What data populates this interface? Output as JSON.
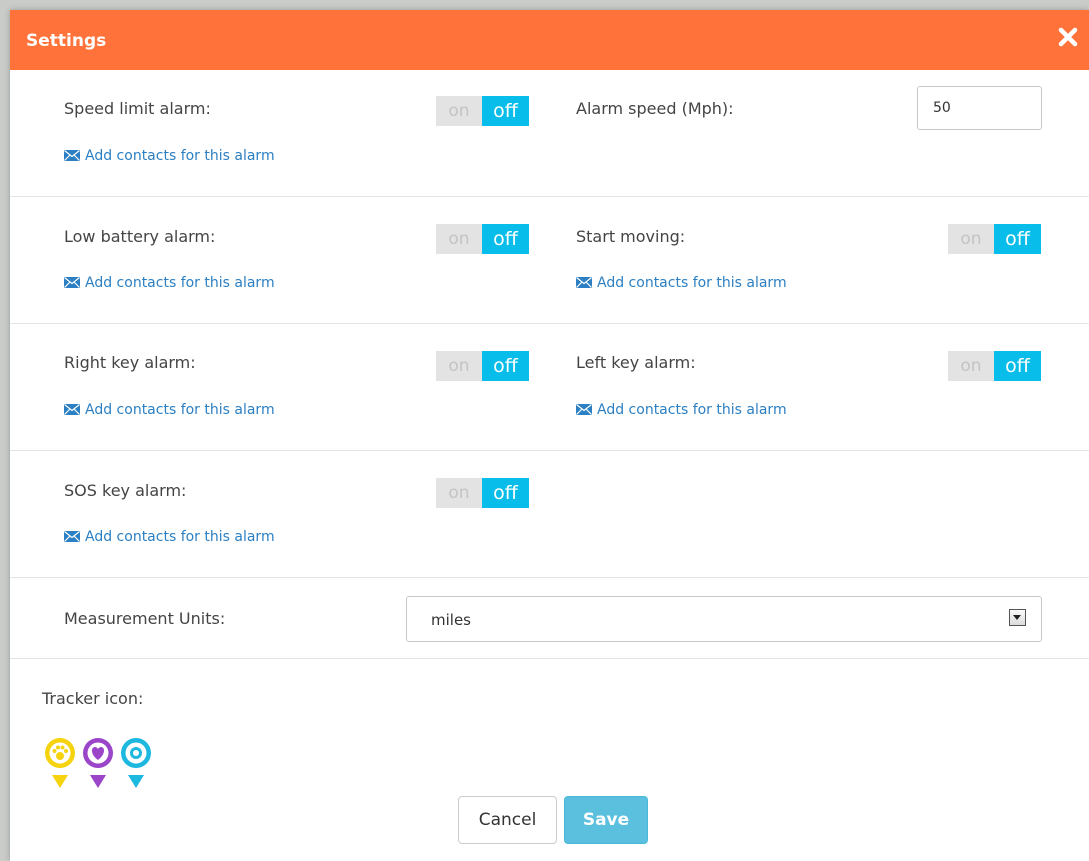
{
  "dialog": {
    "title": "Settings",
    "close_icon": "close-icon",
    "accent_color": "#ff733a"
  },
  "toggle_labels": {
    "on": "on",
    "off": "off"
  },
  "add_contacts_label": "Add contacts for this alarm",
  "alarms": {
    "speed_limit": {
      "label": "Speed limit alarm:",
      "state": "off"
    },
    "alarm_speed": {
      "label": "Alarm speed (Mph):",
      "value": "50"
    },
    "low_battery": {
      "label": "Low battery alarm:",
      "state": "off"
    },
    "start_moving": {
      "label": "Start moving:",
      "state": "off"
    },
    "right_key": {
      "label": "Right key alarm:",
      "state": "off"
    },
    "left_key": {
      "label": "Left key alarm:",
      "state": "off"
    },
    "sos_key": {
      "label": "SOS key alarm:",
      "state": "off"
    }
  },
  "measurement": {
    "label": "Measurement Units:",
    "selected": "miles"
  },
  "tracker_icon": {
    "label": "Tracker icon:",
    "icons": [
      {
        "name": "paw-pin-icon",
        "color": "#f5d30f"
      },
      {
        "name": "heart-pin-icon",
        "color": "#9b45c9"
      },
      {
        "name": "ring-pin-icon",
        "color": "#1cb8e0"
      }
    ]
  },
  "buttons": {
    "cancel": "Cancel",
    "save": "Save"
  },
  "colors": {
    "toggle_off": "#08bde9",
    "toggle_on": "#e3e3e3",
    "link": "#2b7fc2",
    "save": "#5bc0de"
  }
}
